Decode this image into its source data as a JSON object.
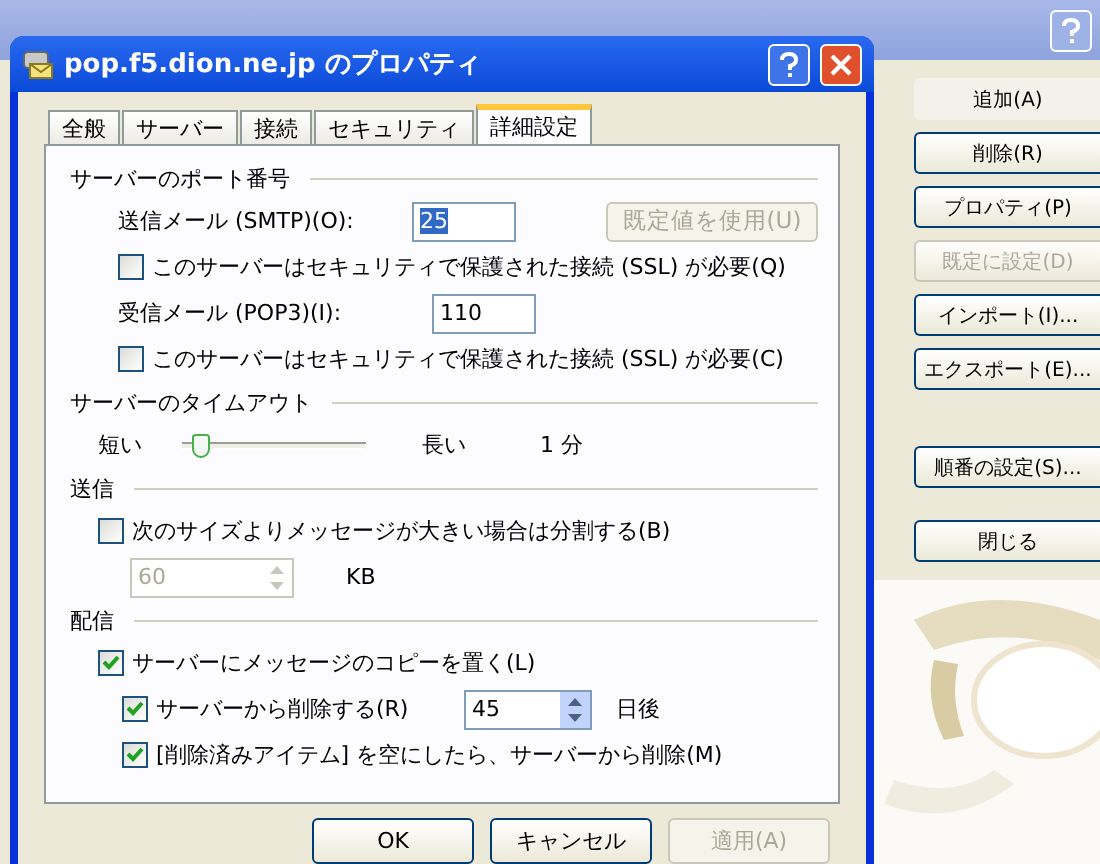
{
  "background_window": {
    "buttons": [
      {
        "label": "追加(A)",
        "disabled": false,
        "selected": true
      },
      {
        "label": "削除(R)",
        "disabled": false,
        "selected": false
      },
      {
        "label": "プロパティ(P)",
        "disabled": false,
        "selected": false
      },
      {
        "label": "既定に設定(D)",
        "disabled": true,
        "selected": false
      },
      {
        "label": "インポート(I)...",
        "disabled": false,
        "selected": false
      },
      {
        "label": "エクスポート(E)...",
        "disabled": false,
        "selected": false
      },
      {
        "label": "順番の設定(S)...",
        "disabled": false,
        "selected": false
      },
      {
        "label": "閉じる",
        "disabled": false,
        "selected": false
      }
    ]
  },
  "dialog": {
    "title": "pop.f5.dion.ne.jp のプロパティ",
    "tabs": [
      {
        "label": "全般",
        "selected": false
      },
      {
        "label": "サーバー",
        "selected": false
      },
      {
        "label": "接続",
        "selected": false
      },
      {
        "label": "セキュリティ",
        "selected": false
      },
      {
        "label": "詳細設定",
        "selected": true
      }
    ],
    "port_section": {
      "heading": "サーバーのポート番号",
      "smtp_label": "送信メール (SMTP)(O):",
      "smtp_value": "25",
      "default_button": {
        "label": "既定値を使用(U)",
        "disabled": true
      },
      "smtp_ssl": {
        "label": "このサーバーはセキュリティで保護された接続 (SSL) が必要(Q)",
        "checked": false
      },
      "pop3_label": "受信メール (POP3)(I):",
      "pop3_value": "110",
      "pop3_ssl": {
        "label": "このサーバーはセキュリティで保護された接続 (SSL) が必要(C)",
        "checked": false
      }
    },
    "timeout_section": {
      "heading": "サーバーのタイムアウト",
      "short_label": "短い",
      "long_label": "長い",
      "level": 0.1,
      "reading": "1 分"
    },
    "send_section": {
      "heading": "送信",
      "split": {
        "label": "次のサイズよりメッセージが大きい場合は分割する(B)",
        "checked": false
      },
      "size_value": "60",
      "size_disabled": true,
      "unit": "KB"
    },
    "delivery_section": {
      "heading": "配信",
      "leave_copy": {
        "label": "サーバーにメッセージのコピーを置く(L)",
        "checked": true
      },
      "remove_after": {
        "label": "サーバーから削除する(R)",
        "checked": true
      },
      "days_value": "45",
      "days_unit": "日後",
      "remove_when_deleted": {
        "label": "[削除済みアイテム] を空にしたら、サーバーから削除(M)",
        "checked": true
      }
    },
    "buttons": [
      {
        "label": "OK",
        "disabled": false
      },
      {
        "label": "キャンセル",
        "disabled": false
      },
      {
        "label": "適用(A)",
        "disabled": true
      }
    ]
  }
}
